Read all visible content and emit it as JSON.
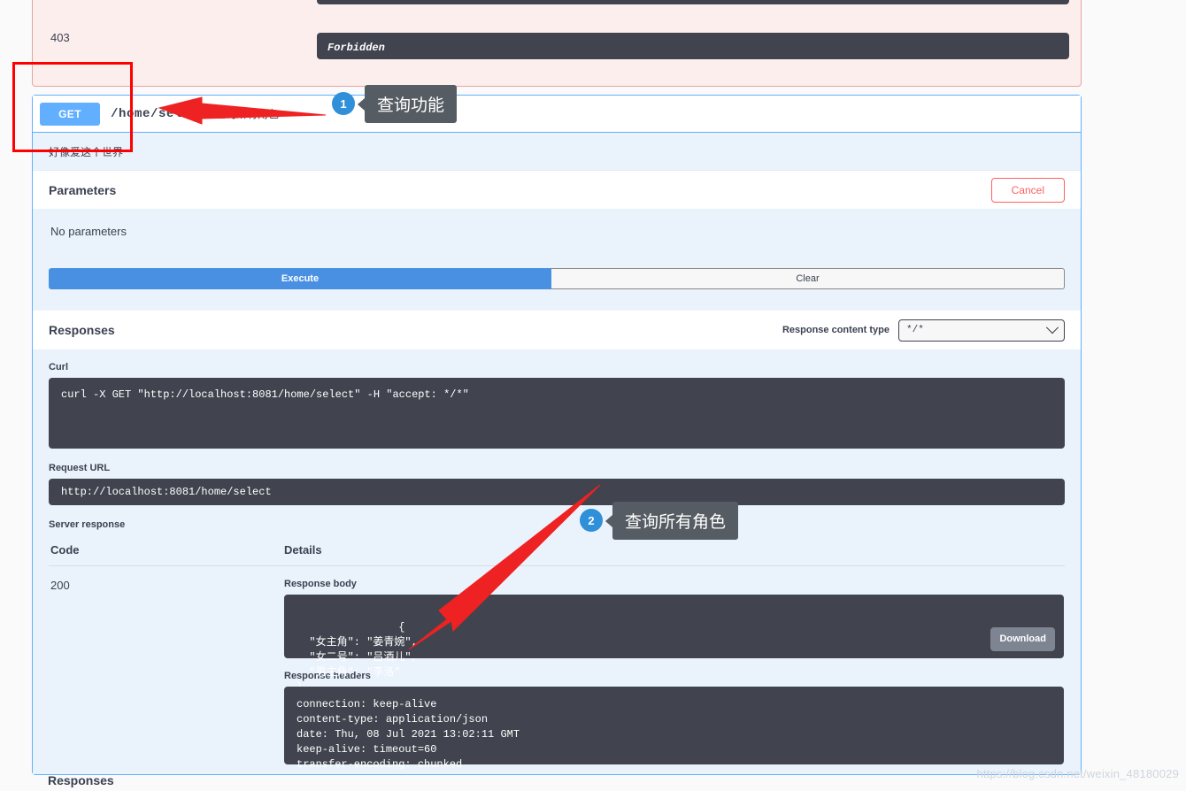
{
  "response_403": {
    "code": "403",
    "description": "Forbidden"
  },
  "operation": {
    "method": "GET",
    "path": "/home/select",
    "summary": "查询所有角色",
    "description": "好像爱这个世界"
  },
  "parameters": {
    "title": "Parameters",
    "cancel_label": "Cancel",
    "empty_text": "No parameters",
    "execute_label": "Execute",
    "clear_label": "Clear"
  },
  "responses": {
    "title": "Responses",
    "content_type_label": "Response content type",
    "content_type_value": "*/*",
    "curl_label": "Curl",
    "curl_value": "curl -X GET \"http://localhost:8081/home/select\" -H \"accept: */*\"",
    "request_url_label": "Request URL",
    "request_url_value": "http://localhost:8081/home/select",
    "server_response_label": "Server response",
    "col_code": "Code",
    "col_details": "Details",
    "status_code": "200",
    "response_body_label": "Response body",
    "response_body_value": "{\n  \"女主角\": \"姜青婉\",\n  \"女二号\": \"吕酒儿\",\n  \"男主角\": \"李洛\"\n}",
    "download_label": "Download",
    "response_headers_label": "Response headers",
    "response_headers_value": "connection: keep-alive \ncontent-type: application/json \ndate: Thu, 08 Jul 2021 13:02:11 GMT \nkeep-alive: timeout=60 \ntransfer-encoding: chunked"
  },
  "bottom_section": {
    "title": "Responses"
  },
  "annotations": [
    {
      "number": "1",
      "text": "查询功能"
    },
    {
      "number": "2",
      "text": "查询所有角色"
    }
  ],
  "watermark": "https://blog.csdn.net/weixin_48180029",
  "colors": {
    "get_blue": "#61affe",
    "execute_blue": "#4990e2",
    "dark_code": "#41444e",
    "error_bg": "#fdeeee",
    "annotation_red": "#ff0000",
    "badge_blue": "#2f8fd8"
  }
}
